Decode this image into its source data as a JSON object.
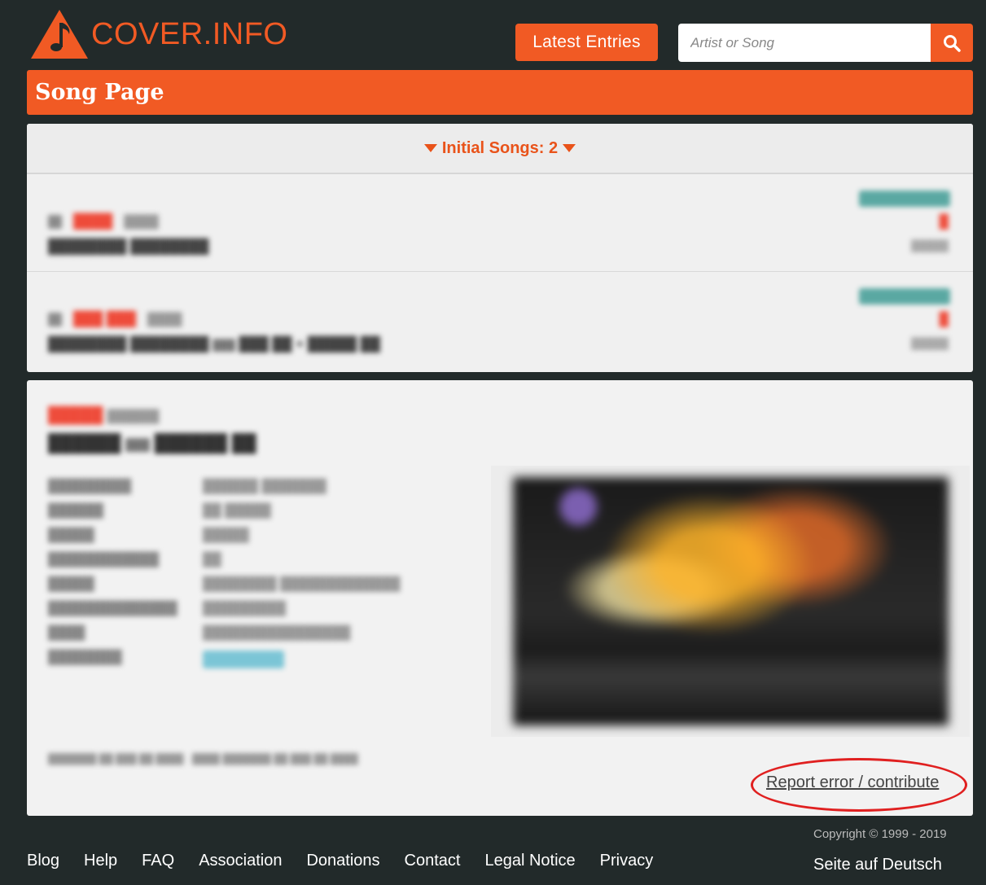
{
  "header": {
    "logo_text": "COVER.INFO",
    "latest_label": "Latest Entries",
    "search_placeholder": "Artist or Song",
    "search_value": ""
  },
  "page": {
    "title": "Song Page"
  },
  "initial_songs": {
    "toggle_label": "Initial Songs: 2"
  },
  "detail": {
    "report_label": "Report error / contribute"
  },
  "footer": {
    "copyright": "Copyright © 1999 - 2019",
    "nav": [
      "Blog",
      "Help",
      "FAQ",
      "Association",
      "Donations",
      "Contact",
      "Legal Notice",
      "Privacy"
    ],
    "language_link": "Seite auf Deutsch"
  },
  "colors": {
    "accent": "#f15a24",
    "background": "#222a2a",
    "annotation": "#e02020"
  },
  "icons": {
    "logo": "note-triangle-icon",
    "search": "search-icon",
    "toggle": "caret-down-icon"
  }
}
